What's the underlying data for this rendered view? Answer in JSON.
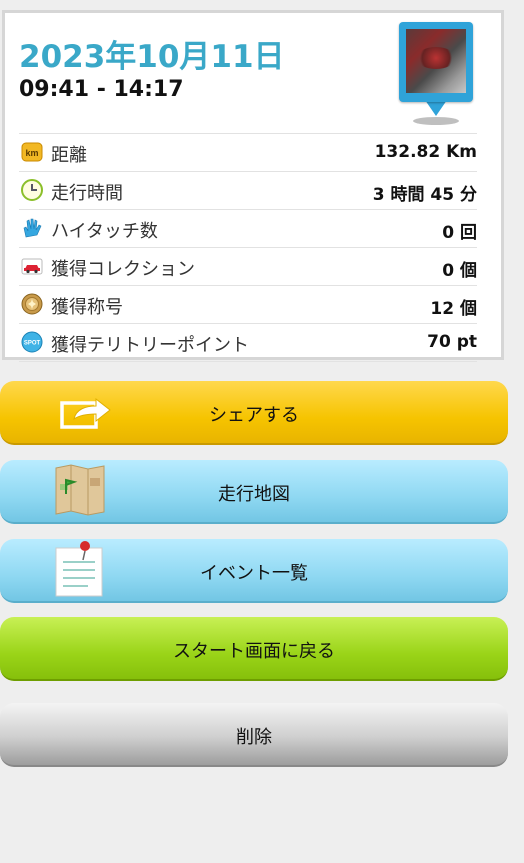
{
  "summary": {
    "date": "2023年10月11日",
    "time_range": "09:41 - 14:17"
  },
  "stats": [
    {
      "icon": "km-icon",
      "label": "距離",
      "value": "132.82 Km"
    },
    {
      "icon": "clock-icon",
      "label": "走行時間",
      "value": "3 時間 45 分"
    },
    {
      "icon": "hand-icon",
      "label": "ハイタッチ数",
      "value": "0 回"
    },
    {
      "icon": "car-icon",
      "label": "獲得コレクション",
      "value": "0 個"
    },
    {
      "icon": "medal-icon",
      "label": "獲得称号",
      "value": "12 個"
    },
    {
      "icon": "spot-icon",
      "label": "獲得テリトリーポイント",
      "value": "70 pt"
    }
  ],
  "icon_text": {
    "km": "km",
    "spot": "SPOT"
  },
  "buttons": {
    "share": "シェアする",
    "map": "走行地図",
    "events": "イベント一覧",
    "back_to_start": "スタート画面に戻る",
    "delete": "削除"
  },
  "colors": {
    "accent": "#3aa8c8",
    "share": "#f6c400",
    "map": "#8fd8f2",
    "start": "#9ad418",
    "delete": "#cfcfcf"
  }
}
